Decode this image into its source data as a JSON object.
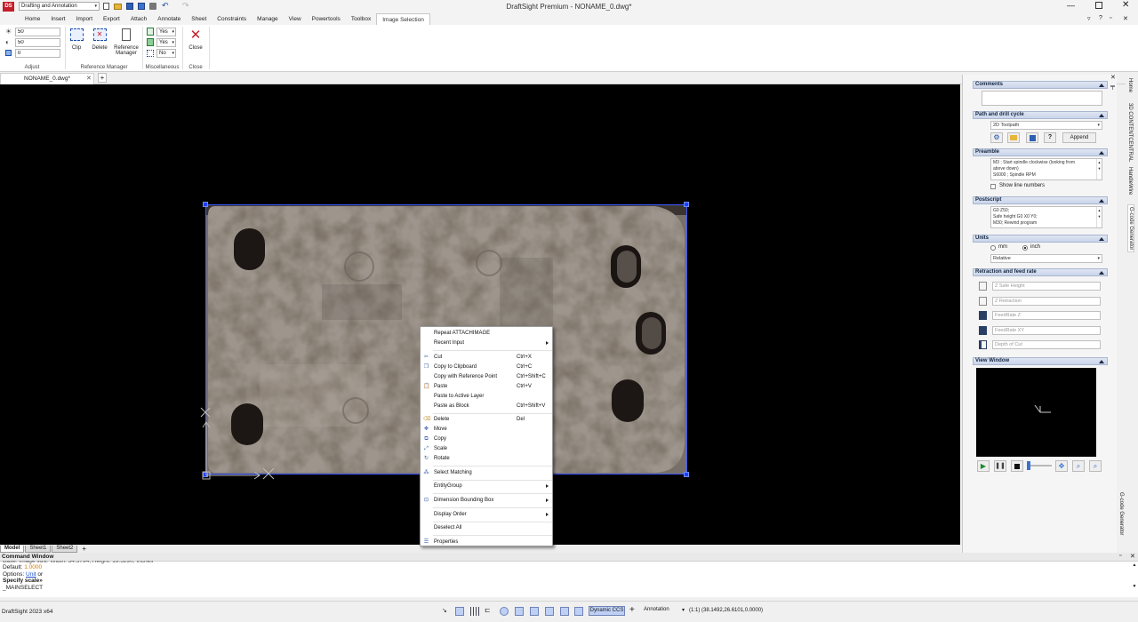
{
  "app": {
    "title": "DraftSight Premium - NONAME_0.dwg*",
    "workspace": "Drafting and Annotation"
  },
  "ribbon": {
    "tabs": [
      "Home",
      "Insert",
      "Import",
      "Export",
      "Attach",
      "Annotate",
      "Sheet",
      "Constraints",
      "Manage",
      "View",
      "Powertools",
      "Toolbox",
      "Image Selection"
    ],
    "adjust": {
      "label": "Adjust",
      "brightness": "50",
      "contrast": "50",
      "fade": "0"
    },
    "refmgr": {
      "label": "Reference Manager",
      "clip": "Clip",
      "delete": "Delete",
      "reference": "Reference",
      "manager": "Manager"
    },
    "misc": {
      "label": "Miscellaneous",
      "v1": "Yes",
      "v2": "Yes",
      "v3": "No"
    },
    "close": {
      "label": "Close",
      "button": "Close"
    }
  },
  "doc_tab": "NONAME_0.dwg*",
  "sheet_tabs": [
    "Model",
    "Sheet1",
    "Sheet2"
  ],
  "context_menu": [
    {
      "label": "Repeat ATTACHIMAGE",
      "shortcut": "",
      "icon": "",
      "arrow": false
    },
    {
      "label": "Recent Input",
      "shortcut": "",
      "icon": "",
      "arrow": true
    },
    {
      "sep": true
    },
    {
      "label": "Cut",
      "shortcut": "Ctrl+X",
      "icon": "cut-icon",
      "arrow": false
    },
    {
      "label": "Copy to Clipboard",
      "shortcut": "Ctrl+C",
      "icon": "copy-icon",
      "arrow": false
    },
    {
      "label": "Copy with Reference Point",
      "shortcut": "Ctrl+Shift+C",
      "icon": "",
      "arrow": false
    },
    {
      "label": "Paste",
      "shortcut": "Ctrl+V",
      "icon": "paste-icon",
      "arrow": false
    },
    {
      "label": "Paste to Active Layer",
      "shortcut": "",
      "icon": "",
      "arrow": false
    },
    {
      "label": "Paste as Block",
      "shortcut": "Ctrl+Shift+V",
      "icon": "",
      "arrow": false
    },
    {
      "sep": true
    },
    {
      "label": "Delete",
      "shortcut": "Del",
      "icon": "eraser-icon",
      "arrow": false
    },
    {
      "label": "Move",
      "shortcut": "",
      "icon": "move-icon",
      "arrow": false
    },
    {
      "label": "Copy",
      "shortcut": "",
      "icon": "copy-entity-icon",
      "arrow": false
    },
    {
      "label": "Scale",
      "shortcut": "",
      "icon": "scale-icon",
      "arrow": false
    },
    {
      "label": "Rotate",
      "shortcut": "",
      "icon": "rotate-icon",
      "arrow": false
    },
    {
      "sep": true
    },
    {
      "label": "Select Matching",
      "shortcut": "",
      "icon": "select-matching-icon",
      "arrow": false
    },
    {
      "sep": true
    },
    {
      "label": "EntityGroup",
      "shortcut": "",
      "icon": "",
      "arrow": true
    },
    {
      "sep": true
    },
    {
      "label": "Dimension Bounding Box",
      "shortcut": "",
      "icon": "dimension-icon",
      "arrow": true
    },
    {
      "sep": true
    },
    {
      "label": "Display Order",
      "shortcut": "",
      "icon": "",
      "arrow": true
    },
    {
      "sep": true
    },
    {
      "label": "Deselect All",
      "shortcut": "",
      "icon": "",
      "arrow": false
    },
    {
      "sep": true
    },
    {
      "label": "Properties",
      "shortcut": "",
      "icon": "properties-icon",
      "arrow": false
    }
  ],
  "panel": {
    "comments": "Comments",
    "path_title": "Path and drill cycle",
    "toolpath": "2D Toolpath",
    "append": "Append",
    "help": "?",
    "preamble_title": "Preamble",
    "preamble_l1": "M3    ; Start spindle clockwise (looking from",
    "preamble_l2": "above down)",
    "preamble_l3": "S6000  ; Spindle RPM",
    "show_line_numbers": "Show line numbers",
    "postscript_title": "Postscript",
    "post_l1": "G0 Z50;",
    "post_l2": "Safe height G0 X0 Y0;",
    "post_l3": "M30; Rewind program",
    "units_title": "Units",
    "mm": "mm",
    "inch": "inch",
    "mode": "Relative",
    "retraction_title": "Retraction and feed rate",
    "z_safe": "Z Safe Height",
    "z_retract": "Z Retraction",
    "feed_z": "FeedRate Z",
    "feed_xy": "FeedRate XY",
    "depth": "Depth of Cut",
    "view_title": "View Window"
  },
  "vtabs": [
    "Home",
    "3D CONTENTCENTRAL",
    "HandleWire",
    "G-code Generator"
  ],
  "panel_vertical_title": "G-code Generator",
  "command": {
    "title": "Command Window",
    "l1": "Base: Image size: Width: 34.5794, Height: 19.5290, Inches",
    "l2a": "Default: ",
    "l2b": "1.0000",
    "l3a": "Options: ",
    "l3b": "Unit",
    "l3c": " or",
    "l4": "Specify scale»",
    "l5": "_MAINSELECT"
  },
  "status": {
    "version": "DraftSight 2023 x64",
    "dynamic": "Dynamic CCS",
    "annotation": "Annotation",
    "scale": "(1:1)",
    "coords": "(38.1492,26.6101,0.0000)"
  }
}
